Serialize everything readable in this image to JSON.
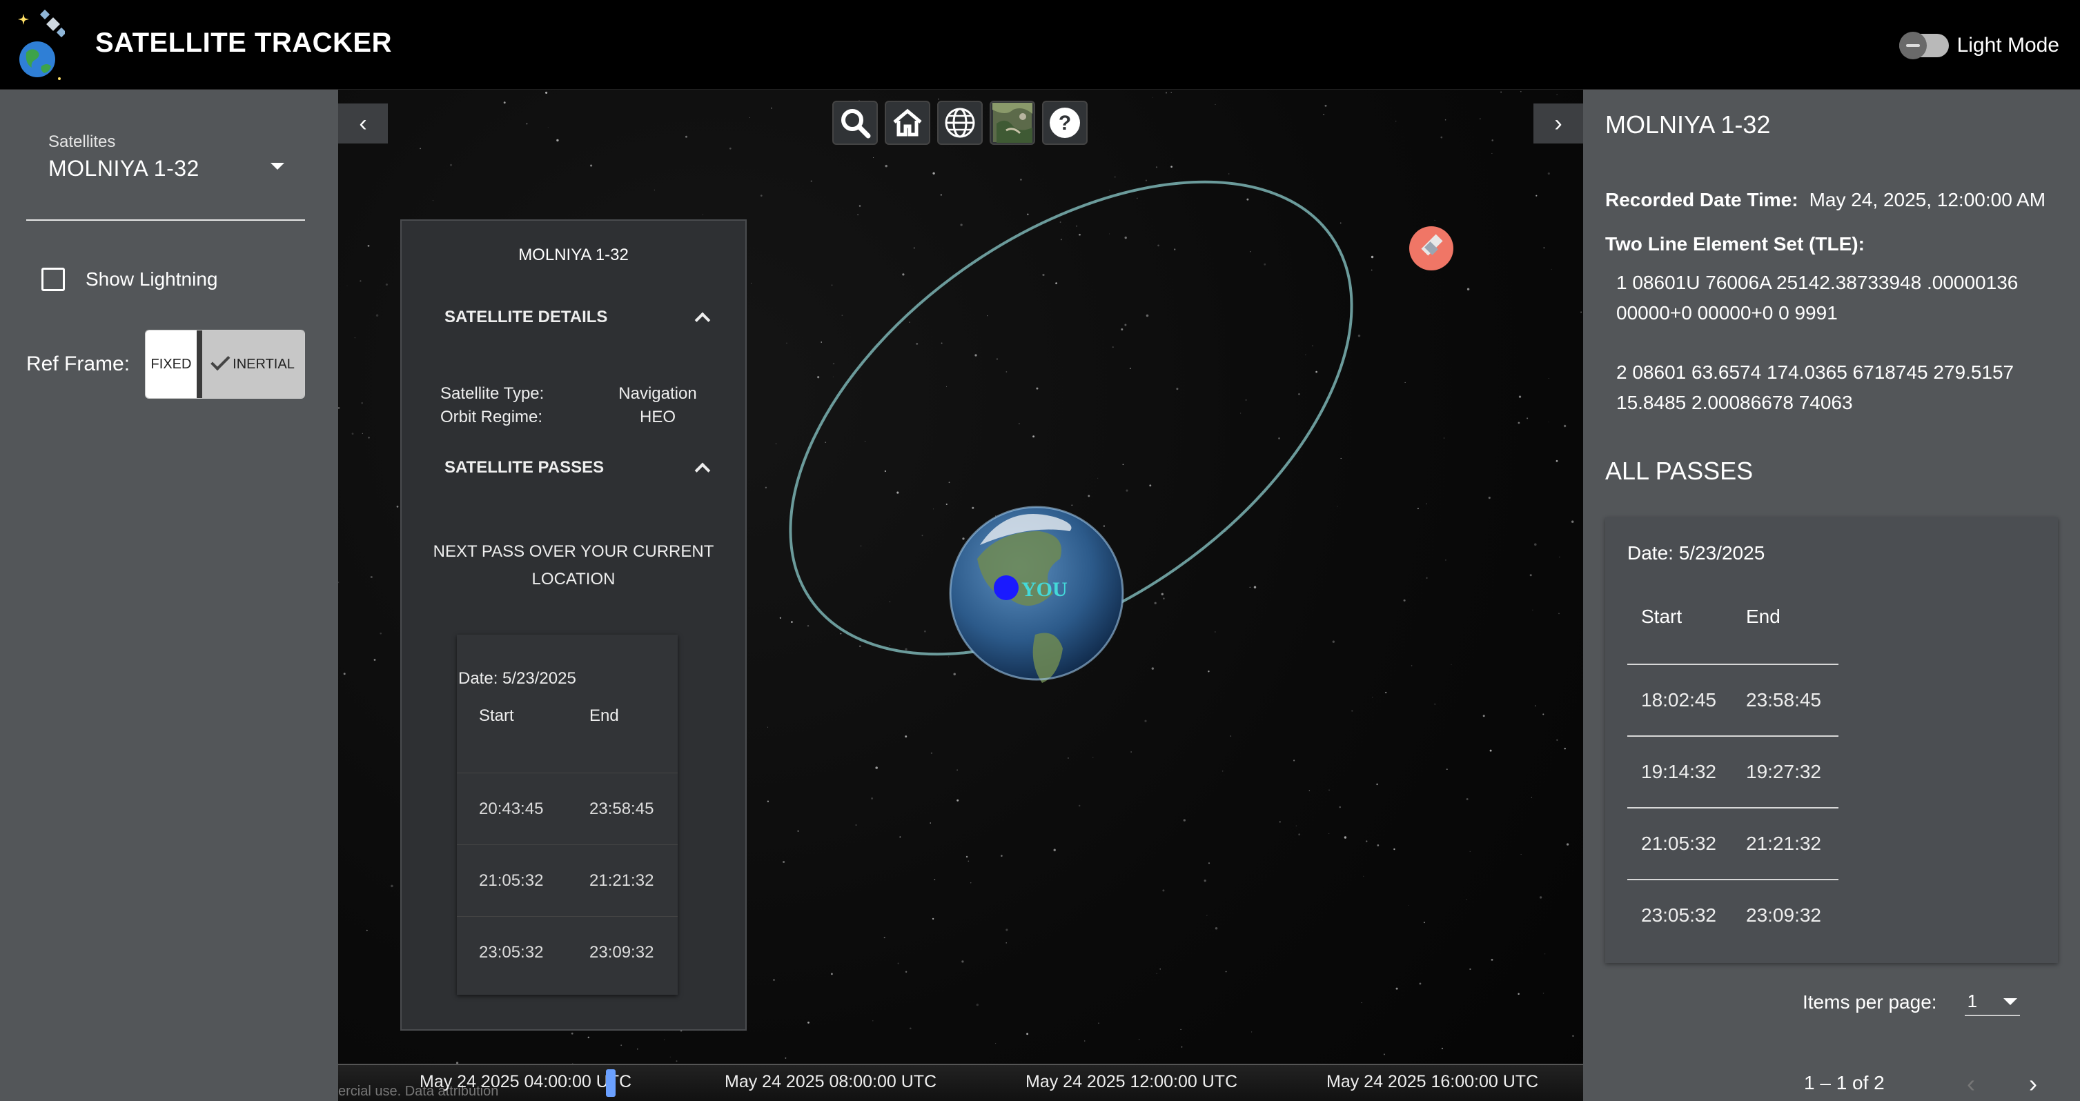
{
  "app": {
    "title": "SATELLITE TRACKER",
    "theme_toggle_label": "Light Mode"
  },
  "left_sidebar": {
    "satellite_select_label": "Satellites",
    "satellite_select_value": "MOLNIYA 1-32",
    "show_lightning_label": "Show Lightning",
    "ref_frame_label": "Ref Frame:",
    "ref_frame_options": [
      "FIXED",
      "INERTIAL"
    ],
    "ref_frame_selected": "INERTIAL"
  },
  "viewer": {
    "toolbar_icons": [
      "search-icon",
      "home-icon",
      "globe-icon",
      "imagery-layer-icon",
      "help-icon"
    ],
    "globe_marker_label": "YOU",
    "colors": {
      "orbit": "#6b9b9b",
      "satellite_marker": "#f07666",
      "user_marker": "#1a1aff",
      "marker_text": "#44d9d9"
    },
    "timeline_labels": [
      "May 24 2025 04:00:00 UTC",
      "May 24 2025 08:00:00 UTC",
      "May 24 2025 12:00:00 UTC",
      "May 24 2025 16:00:00 UTC"
    ],
    "credit": "ercial use. Data attribution"
  },
  "info_panel": {
    "title": "MOLNIYA 1-32",
    "details_heading": "SATELLITE DETAILS",
    "satellite_type_label": "Satellite Type:",
    "satellite_type_value": "Navigation",
    "orbit_regime_label": "Orbit Regime:",
    "orbit_regime_value": "HEO",
    "passes_heading": "SATELLITE PASSES",
    "next_pass_text": "NEXT PASS OVER YOUR CURRENT LOCATION",
    "pass_date": "Date: 5/23/2025",
    "columns": [
      "Start",
      "End"
    ],
    "rows": [
      [
        "20:43:45",
        "23:58:45"
      ],
      [
        "21:05:32",
        "21:21:32"
      ],
      [
        "23:05:32",
        "23:09:32"
      ]
    ]
  },
  "right_sidebar": {
    "title": "MOLNIYA 1-32",
    "recorded_label": "Recorded Date Time:",
    "recorded_value": "May 24, 2025, 12:00:00 AM",
    "tle_label": "Two Line Element Set (TLE):",
    "tle_line1": "1 08601U 76006A 25142.38733948 .00000136 00000+0 00000+0 0 9991",
    "tle_line2": "2 08601 63.6574 174.0365 6718745 279.5157 15.8485 2.00086678 74063",
    "all_passes_heading": "ALL PASSES",
    "pass_date": "Date: 5/23/2025",
    "columns": [
      "Start",
      "End"
    ],
    "rows": [
      [
        "18:02:45",
        "23:58:45"
      ],
      [
        "19:14:32",
        "19:27:32"
      ],
      [
        "21:05:32",
        "21:21:32"
      ],
      [
        "23:05:32",
        "23:09:32"
      ]
    ],
    "items_per_page_label": "Items per page:",
    "items_per_page_value": "1",
    "range_label": "1 – 1 of 2"
  }
}
